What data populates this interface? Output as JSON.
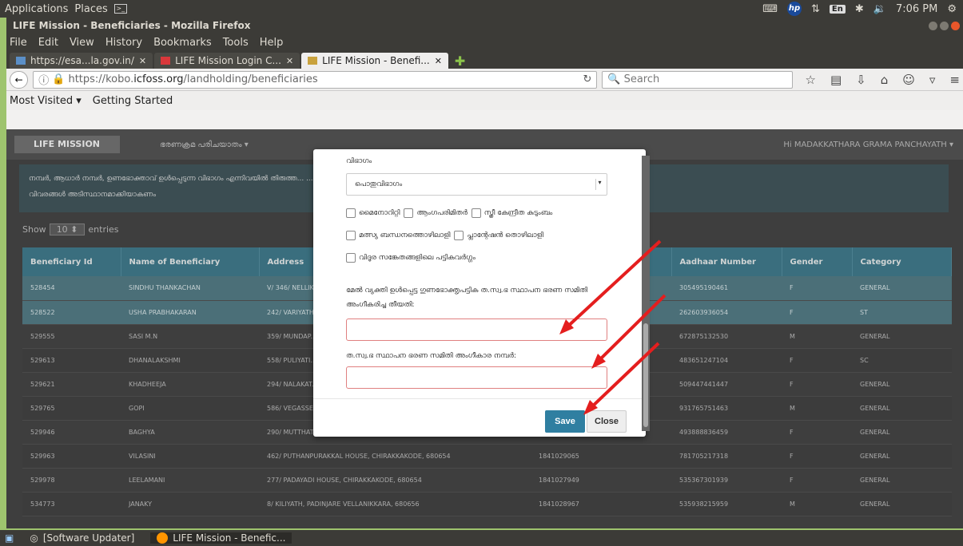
{
  "system": {
    "applications": "Applications",
    "places": "Places",
    "terminal_glyph": ">_",
    "lang": "En",
    "time": "7:06 PM"
  },
  "window": {
    "title": "LIFE Mission - Beneficiaries - Mozilla Firefox"
  },
  "menu": [
    "File",
    "Edit",
    "View",
    "History",
    "Bookmarks",
    "Tools",
    "Help"
  ],
  "tabs": [
    {
      "label": "https://esa...la.gov.in/"
    },
    {
      "label": "LIFE Mission Login C..."
    },
    {
      "label": "LIFE Mission - Benefi..."
    }
  ],
  "nav": {
    "url_prefix": "https://kobo.",
    "url_domain": "icfoss.org",
    "url_path": "/landholding/beneficiaries",
    "search_placeholder": "Search"
  },
  "bookmarks": [
    "Most Visited ▾",
    "Getting Started"
  ],
  "app": {
    "logo": "LIFE MISSION",
    "menu": "ഭരണക്രമ പരിചയാതം ▾",
    "user": "Hi MADAKKATHARA GRAMA PANCHAYATH ▾",
    "notice_line1": "നമ്പർ, ആധാർ നമ്പർ, ഉണഭോക്താവ് ഉൾപ്പെടുന്ന വിഭാഗം എന്നിവയിൽ തിരുത്ത...  ...ഥവാ സെക്രട്ടറി പുതുമപ്പെടുത്തിയാൾ പരിശോധിച്ച് ബോധ്യപ്പെട്ട",
    "notice_line2": "വിവരങ്ങൾ അടിസ്ഥാനമാക്കിയാകണം",
    "show": "Show",
    "entries_count": "10",
    "entries": "entries"
  },
  "columns": [
    "Beneficiary Id",
    "Name of Beneficiary",
    "Address",
    "",
    "Aadhaar Number",
    "Gender",
    "Category"
  ],
  "rows": [
    {
      "id": "528454",
      "name": "SINDHU THANKACHAN",
      "address": "V/ 346/ NELLIK...",
      "ration": "",
      "aadhaar": "305495190461",
      "gender": "F",
      "category": "GENERAL"
    },
    {
      "id": "528522",
      "name": "USHA PRABHAKARAN",
      "address": "242/ VARIYATH...",
      "ration": "",
      "aadhaar": "262603936054",
      "gender": "F",
      "category": "ST"
    },
    {
      "id": "529555",
      "name": "SASI M.N",
      "address": "359/ MUNDAP...",
      "ration": "",
      "aadhaar": "672875132530",
      "gender": "M",
      "category": "GENERAL"
    },
    {
      "id": "529613",
      "name": "DHANALAKSHMI",
      "address": "558/ PULIYATI...",
      "ration": "",
      "aadhaar": "483651247104",
      "gender": "F",
      "category": "SC"
    },
    {
      "id": "529621",
      "name": "KHADHEEJA",
      "address": "294/ NALAKAT...",
      "ration": "",
      "aadhaar": "509447441447",
      "gender": "F",
      "category": "GENERAL"
    },
    {
      "id": "529765",
      "name": "GOPI",
      "address": "586/ VEGASSE...",
      "ration": "",
      "aadhaar": "931765751463",
      "gender": "M",
      "category": "GENERAL"
    },
    {
      "id": "529946",
      "name": "BAGHYA",
      "address": "290/ MUTTHATT HOUSE, CHIRAKKAKODE, 680654",
      "ration": "1841027950",
      "aadhaar": "493888836459",
      "gender": "F",
      "category": "GENERAL"
    },
    {
      "id": "529963",
      "name": "VILASINI",
      "address": "462/ PUTHANPURAKKAL HOUSE, CHIRAKKAKODE, 680654",
      "ration": "1841029065",
      "aadhaar": "781705217318",
      "gender": "F",
      "category": "GENERAL"
    },
    {
      "id": "529978",
      "name": "LEELAMANI",
      "address": "277/ PADAYADI HOUSE, CHIRAKKAKODE, 680654",
      "ration": "1841027949",
      "aadhaar": "535367301939",
      "gender": "F",
      "category": "GENERAL"
    },
    {
      "id": "534773",
      "name": "JANAKY",
      "address": "8/ KILIYATH, PADINJARE VELLANIKKARA, 680656",
      "ration": "1841028967",
      "aadhaar": "535938215959",
      "gender": "M",
      "category": "GENERAL"
    }
  ],
  "modal": {
    "category_label": "വിഭാഗം",
    "category_value": "പൊതുവിഭാഗം",
    "checks": [
      "മൈനോറിറ്റി",
      "ആംഗപരിമിതർ",
      "സ്ത്രീ കേന്ദ്രീത കുടുംബം",
      "മത്സ്യ ബന്ധനത്തൊഴിലാളി",
      "പ്ലാന്റേഷൻ തൊഴിലാളി",
      "വിദൂര സങ്കേതങ്ങളിലെ പട്ടികവർഗ്ഗം"
    ],
    "date_label": "മേൽ വ്യക്തി ഉൾപ്പെട്ട ഗുണഭോക്തൃപട്ടിക ത.സ്വ.ഭ സ്ഥാപന ഭരണ സമിതി അംഗീകരിച്ച തീയതി:",
    "num_label": "ത.സ്വ.ഭ സ്ഥാപന ഭരണ സമിതി അംഗീകാര നമ്പർ:",
    "save": "Save",
    "close": "Close"
  },
  "taskbar": [
    {
      "label": "[Software Updater]"
    },
    {
      "label": "LIFE Mission - Benefic..."
    }
  ],
  "colors": {
    "highlight_border": "#e08080",
    "arrow": "#e41e1e",
    "save": "#2f7fa1"
  }
}
